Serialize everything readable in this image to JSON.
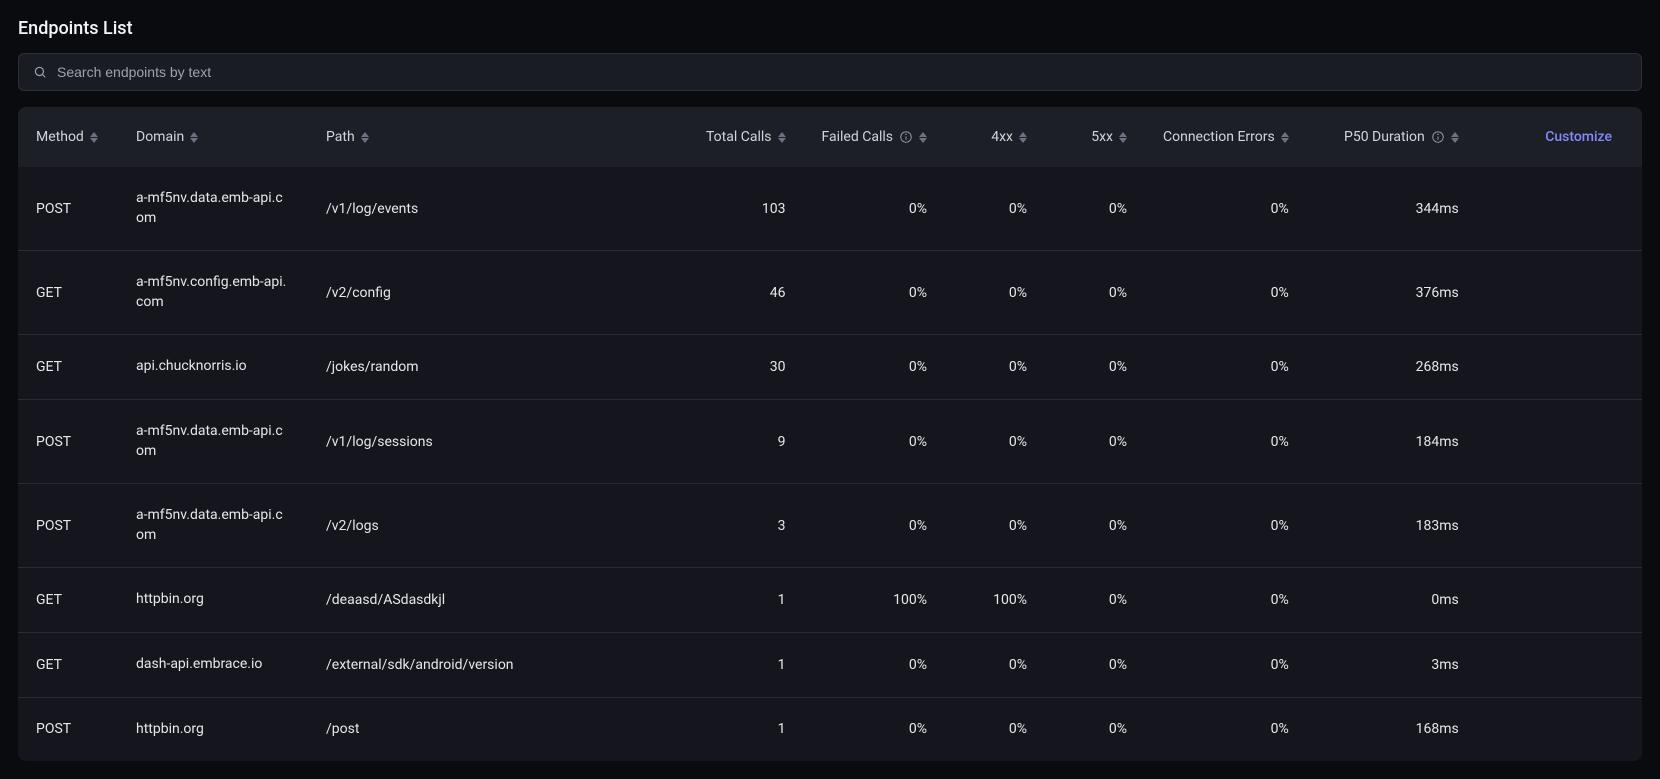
{
  "title": "Endpoints List",
  "search": {
    "placeholder": "Search endpoints by text"
  },
  "columns": {
    "method": "Method",
    "domain": "Domain",
    "path": "Path",
    "totalCalls": "Total Calls",
    "failedCalls": "Failed Calls",
    "fourxx": "4xx",
    "fivexx": "5xx",
    "connErrors": "Connection Errors",
    "p50": "P50 Duration",
    "customize": "Customize"
  },
  "rows": [
    {
      "method": "POST",
      "domain": "a-mf5nv.data.emb-api.com",
      "path": "/v1/log/events",
      "total": "103",
      "failed": "0%",
      "fourxx": "0%",
      "fivexx": "0%",
      "conn": "0%",
      "p50": "344ms"
    },
    {
      "method": "GET",
      "domain": "a-mf5nv.config.emb-api.com",
      "path": "/v2/config",
      "total": "46",
      "failed": "0%",
      "fourxx": "0%",
      "fivexx": "0%",
      "conn": "0%",
      "p50": "376ms"
    },
    {
      "method": "GET",
      "domain": "api.chucknorris.io",
      "path": "/jokes/random",
      "total": "30",
      "failed": "0%",
      "fourxx": "0%",
      "fivexx": "0%",
      "conn": "0%",
      "p50": "268ms"
    },
    {
      "method": "POST",
      "domain": "a-mf5nv.data.emb-api.com",
      "path": "/v1/log/sessions",
      "total": "9",
      "failed": "0%",
      "fourxx": "0%",
      "fivexx": "0%",
      "conn": "0%",
      "p50": "184ms"
    },
    {
      "method": "POST",
      "domain": "a-mf5nv.data.emb-api.com",
      "path": "/v2/logs",
      "total": "3",
      "failed": "0%",
      "fourxx": "0%",
      "fivexx": "0%",
      "conn": "0%",
      "p50": "183ms"
    },
    {
      "method": "GET",
      "domain": "httpbin.org",
      "path": "/deaasd/ASdasdkjl",
      "total": "1",
      "failed": "100%",
      "fourxx": "100%",
      "fivexx": "0%",
      "conn": "0%",
      "p50": "0ms"
    },
    {
      "method": "GET",
      "domain": "dash-api.embrace.io",
      "path": "/external/sdk/android/version",
      "total": "1",
      "failed": "0%",
      "fourxx": "0%",
      "fivexx": "0%",
      "conn": "0%",
      "p50": "3ms"
    },
    {
      "method": "POST",
      "domain": "httpbin.org",
      "path": "/post",
      "total": "1",
      "failed": "0%",
      "fourxx": "0%",
      "fivexx": "0%",
      "conn": "0%",
      "p50": "168ms"
    }
  ]
}
